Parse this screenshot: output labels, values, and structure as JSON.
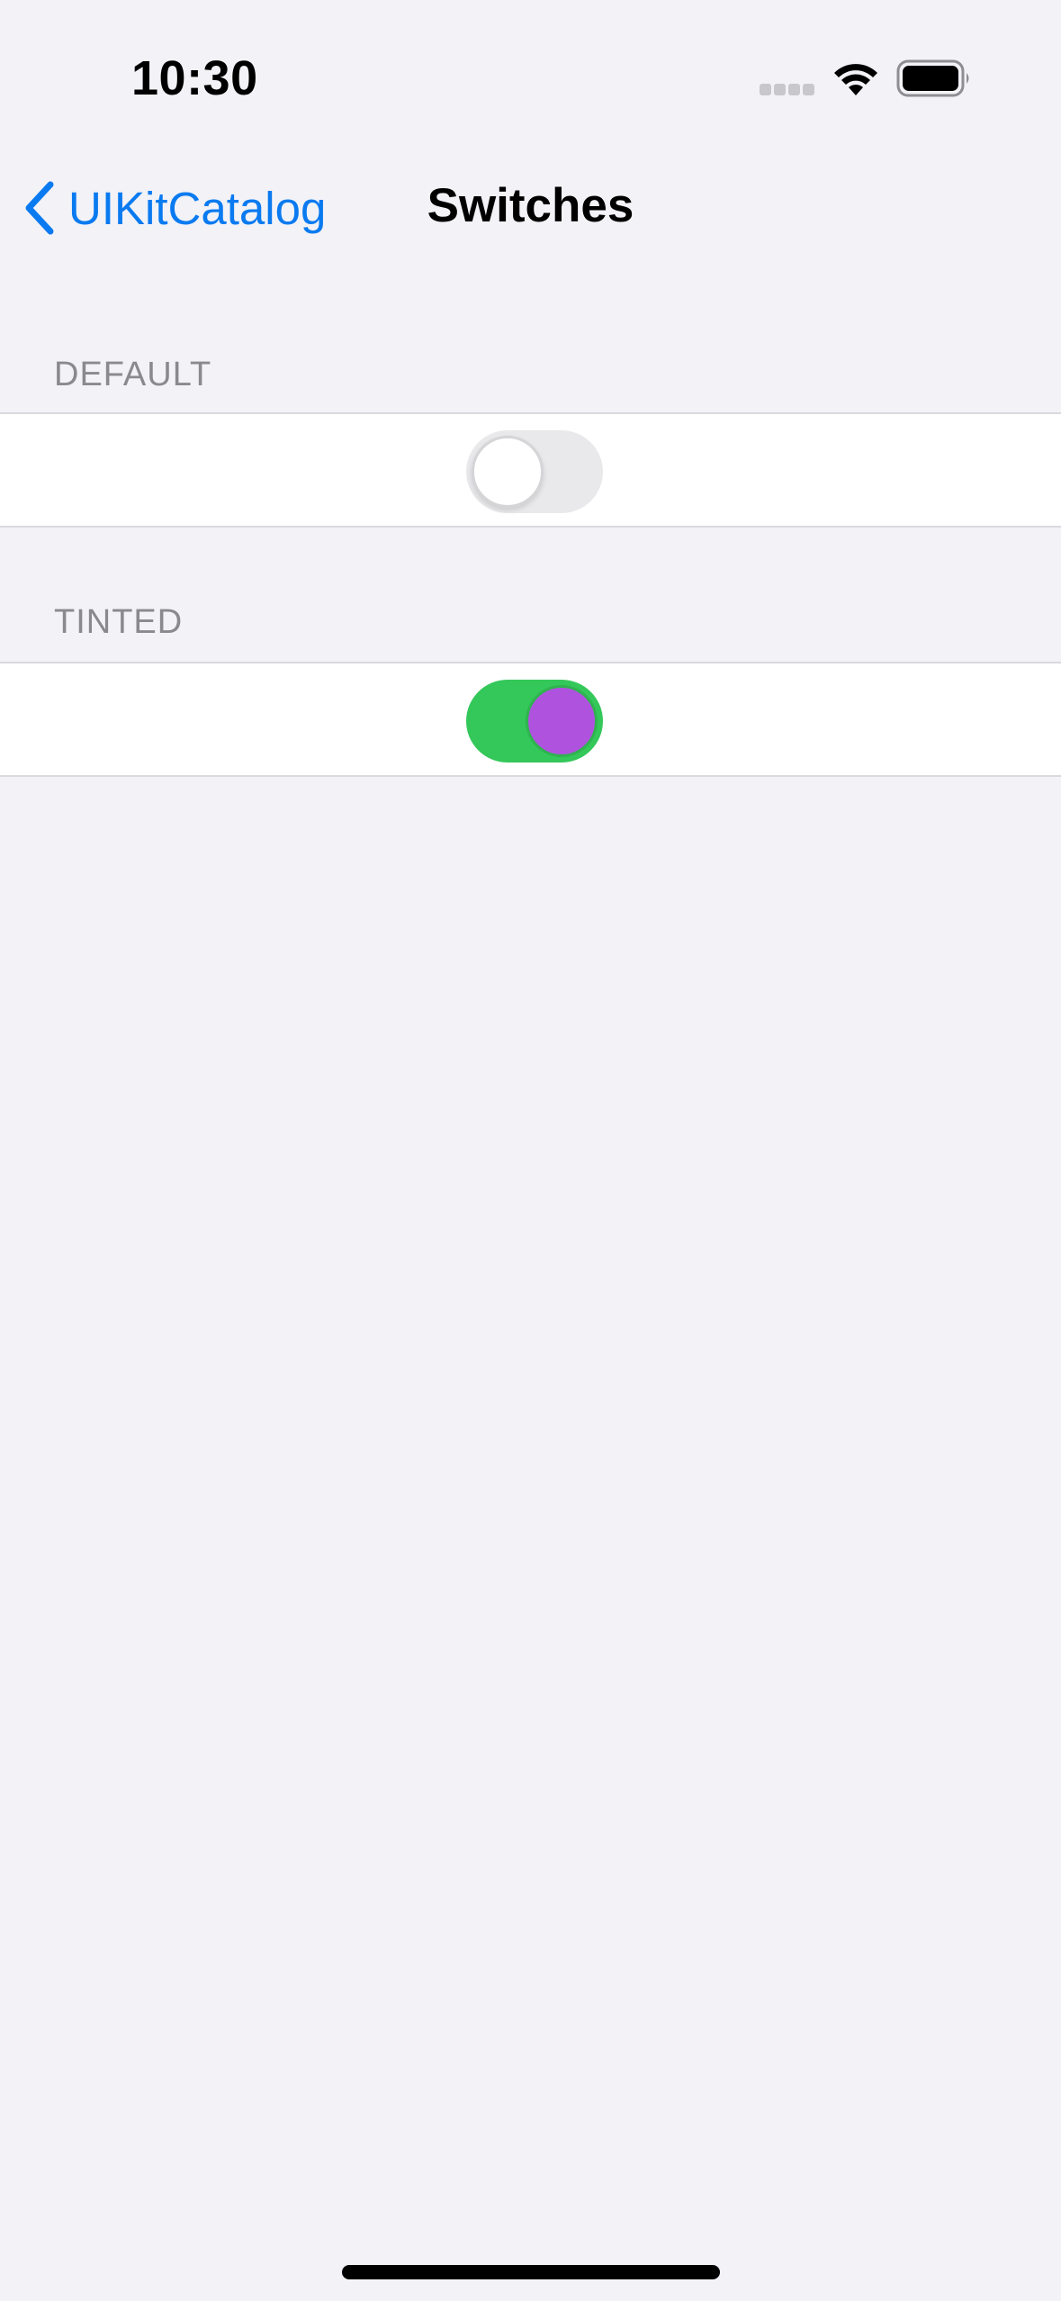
{
  "status_bar": {
    "time": "10:30",
    "signal_icon": "cellular-signal-icon",
    "wifi_icon": "wifi-icon",
    "battery_icon": "battery-icon"
  },
  "nav": {
    "back_label": "UIKitCatalog",
    "back_icon": "chevron-left-icon",
    "title": "Switches"
  },
  "sections": {
    "default": {
      "header": "DEFAULT",
      "switch_on": false
    },
    "tinted": {
      "header": "TINTED",
      "switch_on": true
    }
  },
  "colors": {
    "background": "#F2F2F7",
    "accent": "#0A7AF0",
    "default_track_off": "#E9E9EB",
    "tinted_track_on": "#34C759",
    "tinted_knob": "#AF52DE"
  }
}
